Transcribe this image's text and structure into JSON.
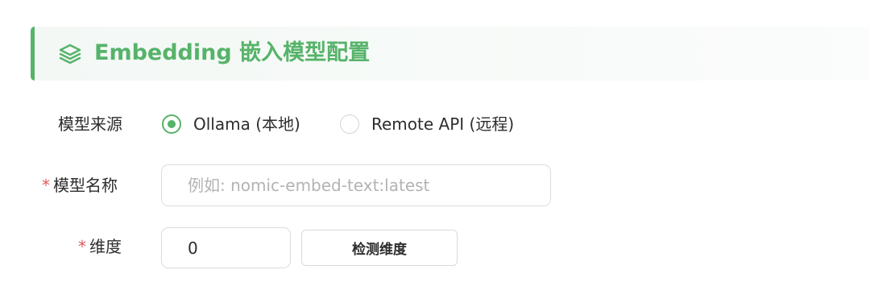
{
  "section": {
    "icon": "layers-icon",
    "title": "Embedding 嵌入模型配置",
    "accent_color": "#56b36a"
  },
  "form": {
    "model_source": {
      "label": "模型来源",
      "options": [
        {
          "label": "Ollama (本地)",
          "checked": true
        },
        {
          "label": "Remote API (远程)",
          "checked": false
        }
      ]
    },
    "model_name": {
      "required_mark": "*",
      "label": "模型名称",
      "value": "",
      "placeholder": "例如: nomic-embed-text:latest"
    },
    "dimension": {
      "required_mark": "*",
      "label": "维度",
      "value": "0",
      "detect_button_label": "检测维度"
    }
  }
}
